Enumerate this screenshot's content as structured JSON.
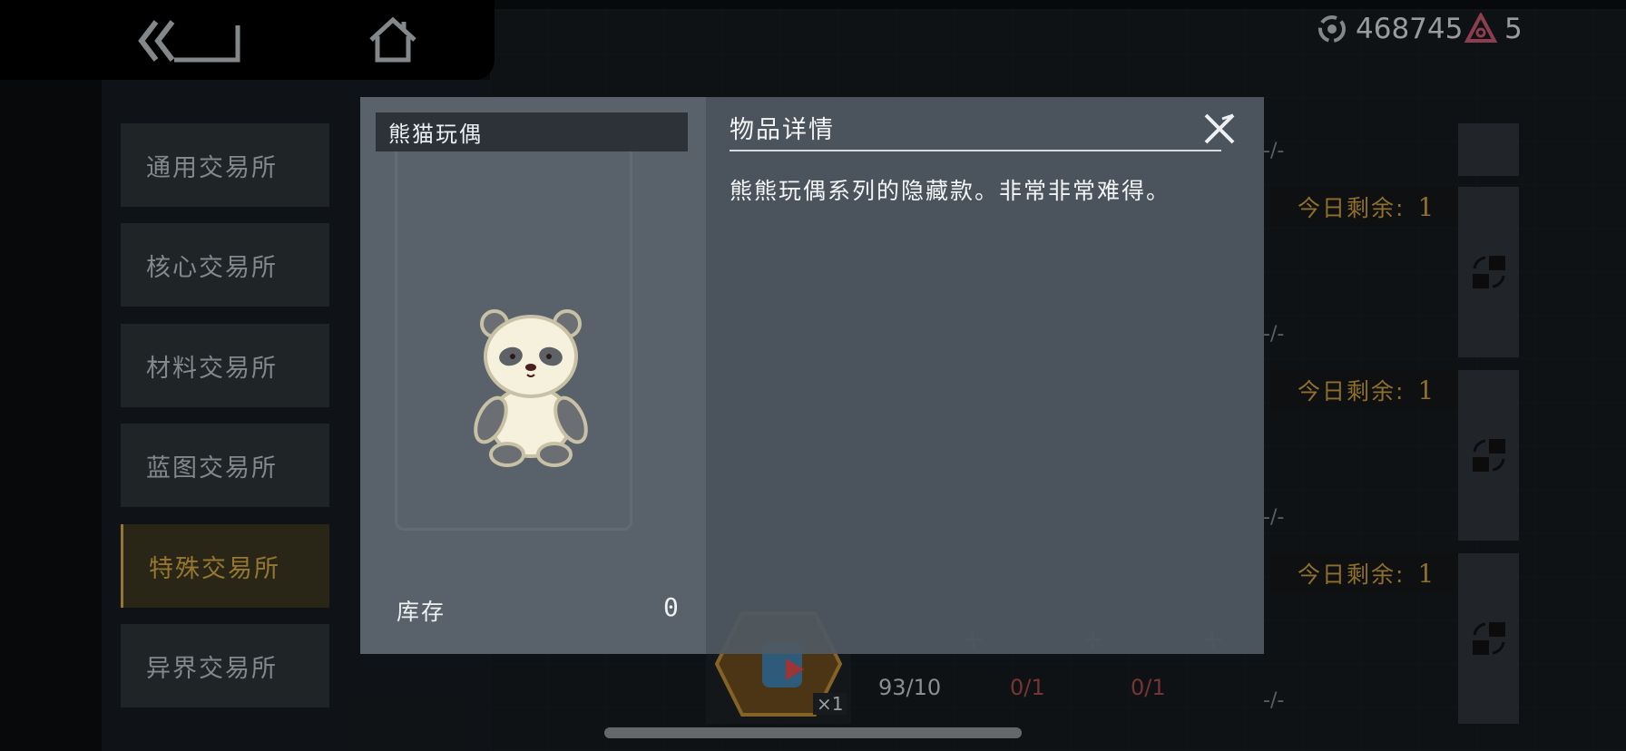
{
  "header": {
    "currency_coins": "468745",
    "currency_gems": "5"
  },
  "sidebar": {
    "items": [
      {
        "label": "通用交易所"
      },
      {
        "label": "核心交易所"
      },
      {
        "label": "材料交易所"
      },
      {
        "label": "蓝图交易所"
      },
      {
        "label": "特殊交易所",
        "active": true
      },
      {
        "label": "异界交易所"
      }
    ]
  },
  "exchange_rows": [
    {
      "remaining_label": "今日剩余:",
      "remaining_count": "1"
    },
    {
      "remaining_label": "今日剩余:",
      "remaining_count": "1"
    },
    {
      "remaining_label": "今日剩余:",
      "remaining_count": "1"
    }
  ],
  "bottom_row": {
    "item_multiplier": "×1",
    "counts": [
      "93/10",
      "0/1",
      "0/1"
    ],
    "dashes": [
      "-/-",
      "-/-",
      "-/-",
      "-/-"
    ],
    "plus": "+"
  },
  "modal": {
    "item_name": "熊猫玩偶",
    "stock_label": "库存",
    "stock_value": "0",
    "detail_title": "物品详情",
    "detail_description": "熊熊玩偶系列的隐藏款。非常非常难得。"
  },
  "colors": {
    "accent_gold": "#cfa646",
    "warning_red": "#a44a44"
  },
  "icons": {
    "back": "double-chevron-back-icon",
    "home": "home-icon",
    "coin": "coin-icon",
    "gem": "gem-icon",
    "exchange": "exchange-arrows-icon",
    "close": "close-icon",
    "item": "panda-doll-icon"
  }
}
